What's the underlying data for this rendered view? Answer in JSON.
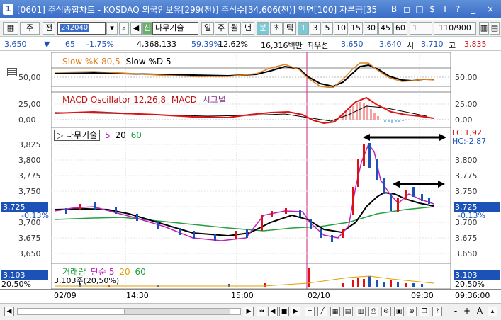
{
  "window": {
    "badge": "1",
    "title": "[0601] 주식종합차트 - KOSDAQ 외국인보유[299(천)] 주식수[34,606(천)] 액면[100] 자본금[35",
    "buttons": [
      "B",
      "◻",
      "□",
      "$",
      "T",
      "?",
      "_",
      "×"
    ]
  },
  "toolbar": {
    "market": "주",
    "period": "전",
    "code": "242040",
    "stock_prefix": "신",
    "stock_name": "나무기술",
    "intervals": [
      "일",
      "주",
      "월",
      "년",
      "분",
      "초",
      "틱"
    ],
    "active_interval": "분",
    "minutes": [
      "1",
      "3",
      "5",
      "10",
      "15",
      "30",
      "45",
      "60"
    ],
    "active_minute": "1",
    "selected_minute": "1",
    "count": "110/900"
  },
  "infobar": {
    "price": "3,650",
    "change": "65",
    "change_pct": "-1.75%",
    "volume": "4,368,133",
    "ratio": "59.39%",
    "turnover": "12.62%",
    "amount": "16,316백만",
    "best_label": "최우선",
    "ask": "3,650",
    "bid": "3,640",
    "open_label": "시",
    "open": "3,710",
    "high_label": "고",
    "high": "3,835"
  },
  "stoch_panel": {
    "label_k": "Slow %K 80,5",
    "label_d": "Slow %D 5",
    "axis": "50,00",
    "color_k": "#e08020",
    "color_d": "#000000"
  },
  "macd_panel": {
    "label_osc": "MACD Oscillator 12,26,8",
    "label_macd": "MACD",
    "label_signal": "시그널",
    "axis_top": "25,00",
    "axis_zero": "0,00",
    "color_macd": "#e01010"
  },
  "price_panel": {
    "stock": "나무기술",
    "ma": [
      "5",
      "20",
      "60"
    ],
    "ma_colors": [
      "#c020c0",
      "#e0a000",
      "#20a040"
    ],
    "ticks": [
      "3,825",
      "3,800",
      "3,775",
      "3,750",
      "3,725",
      "3,700",
      "3,675",
      "3,650"
    ],
    "current": "3,725",
    "current_pct": "-0.13%",
    "lc": "LC:1,92",
    "hc": "HC:-2,87"
  },
  "volume_panel": {
    "label": "거래량",
    "ma_label": "단순",
    "ma": [
      "5",
      "20",
      "60"
    ],
    "value": "3,103",
    "value_pct": "20,50%",
    "desc": "3,103주(20,50%)"
  },
  "dates": [
    "02/09",
    "14:30",
    "15:00",
    "02/10",
    "09:30",
    "09:36:00"
  ],
  "statusbar": {
    "zoom_out": "-",
    "zoom_in": "+",
    "font": "A"
  },
  "colors": {
    "up": "#e01010",
    "down": "#1c52b8",
    "accent": "#3a6ec8"
  }
}
